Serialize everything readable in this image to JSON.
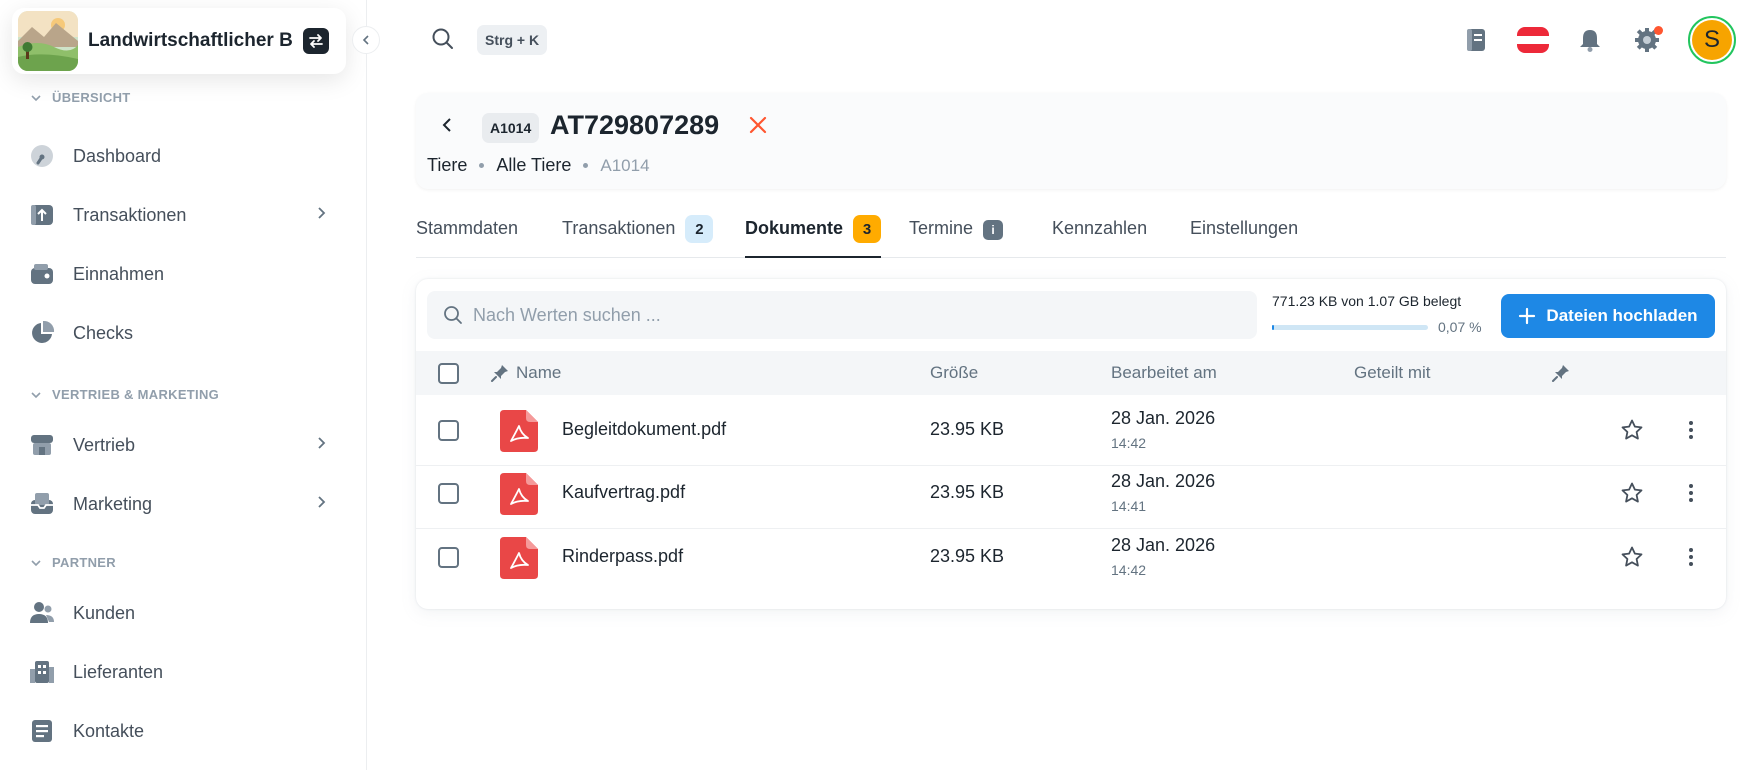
{
  "workspace": {
    "name": "Landwirtschaftlicher B...",
    "switch_icon": "swap-icon"
  },
  "sidebar": {
    "sections": [
      {
        "title": "ÜBERSICHT"
      },
      {
        "title": "VERTRIEB & MARKETING"
      },
      {
        "title": "PARTNER"
      }
    ],
    "items": [
      {
        "label": "Dashboard",
        "icon": "gauge-icon"
      },
      {
        "label": "Transaktionen",
        "icon": "transactions-icon"
      },
      {
        "label": "Einnahmen",
        "icon": "wallet-icon"
      },
      {
        "label": "Checks",
        "icon": "pie-chart-icon"
      },
      {
        "label": "Vertrieb",
        "icon": "store-icon"
      },
      {
        "label": "Marketing",
        "icon": "inbox-icon"
      },
      {
        "label": "Kunden",
        "icon": "users-icon"
      },
      {
        "label": "Lieferanten",
        "icon": "building-icon"
      },
      {
        "label": "Kontakte",
        "icon": "contact-book-icon"
      }
    ]
  },
  "topbar": {
    "shortcut": "Strg + K",
    "avatar_letter": "S"
  },
  "header": {
    "chip": "A1014",
    "title": "AT729807289",
    "breadcrumbs": [
      "Tiere",
      "Alle Tiere",
      "A1014"
    ]
  },
  "tabs": [
    {
      "label": "Stammdaten",
      "badge": ""
    },
    {
      "label": "Transaktionen",
      "badge": "2"
    },
    {
      "label": "Dokumente",
      "badge": "3"
    },
    {
      "label": "Termine",
      "badge": "i"
    },
    {
      "label": "Kennzahlen",
      "badge": ""
    },
    {
      "label": "Einstellungen",
      "badge": ""
    }
  ],
  "documents": {
    "search_placeholder": "Nach Werten suchen ...",
    "storage_text": "771.23 KB von 1.07 GB belegt",
    "storage_percent_label": "0,07 %",
    "storage_fraction": 0.0007,
    "upload_label": "Dateien hochladen",
    "columns": [
      "Name",
      "Größe",
      "Bearbeitet am",
      "Geteilt mit"
    ],
    "rows": [
      {
        "name": "Begleitdokument.pdf",
        "size": "23.95 KB",
        "date": "28 Jan. 2026",
        "time": "14:42"
      },
      {
        "name": "Kaufvertrag.pdf",
        "size": "23.95 KB",
        "date": "28 Jan. 2026",
        "time": "14:41"
      },
      {
        "name": "Rinderpass.pdf",
        "size": "23.95 KB",
        "date": "28 Jan. 2026",
        "time": "14:42"
      }
    ]
  },
  "colors": {
    "accent": "#1e88e5",
    "pdf": "#e94747",
    "badge_orange": "#ffab00",
    "close": "#ff5630"
  }
}
